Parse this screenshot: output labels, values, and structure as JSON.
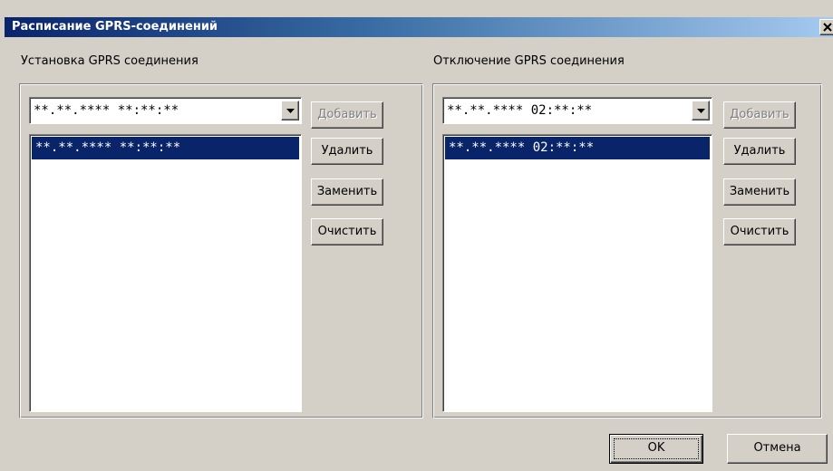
{
  "window": {
    "title": "Расписание GPRS-соединений"
  },
  "connect_group": {
    "label": "Установка GPRS соединения",
    "combo_value": "**.**.**** **:**:**",
    "list_items": [
      "**.**.**** **:**:**"
    ],
    "buttons": {
      "add": "Добавить",
      "delete": "Удалить",
      "replace": "Заменить",
      "clear": "Очистить"
    }
  },
  "disconnect_group": {
    "label": "Отключение GPRS соединения",
    "combo_value": "**.**.**** 02:**:**",
    "list_items": [
      "**.**.**** 02:**:**"
    ],
    "buttons": {
      "add": "Добавить",
      "delete": "Удалить",
      "replace": "Заменить",
      "clear": "Очистить"
    }
  },
  "footer": {
    "ok": "OK",
    "cancel": "Отмена"
  },
  "icons": {
    "close": "close-icon",
    "dropdown": "chevron-down-icon"
  },
  "colors": {
    "titlebar_start": "#0a246a",
    "titlebar_end": "#a6caf0",
    "selection": "#0a246a",
    "face": "#d4d0c8"
  }
}
